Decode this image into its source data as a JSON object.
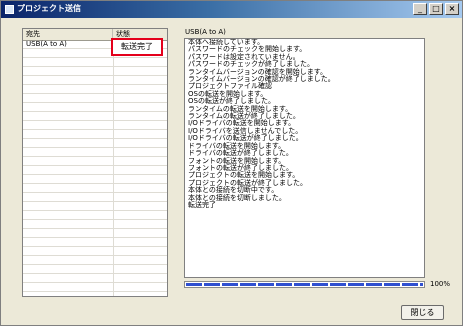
{
  "window": {
    "title": "プロジェクト送信",
    "minimize_glyph": "_",
    "maximize_glyph": "□",
    "close_glyph": "×"
  },
  "list": {
    "headers": {
      "destination": "宛先",
      "status": "状態"
    },
    "rows": [
      {
        "destination": "USB(A to A)",
        "status": "転送完了"
      }
    ]
  },
  "log": {
    "label": "USB(A to A)",
    "lines": [
      "本体へ接続しています。",
      "パスワードのチェックを開始します。",
      "パスワードは設定されていません。",
      "パスワードのチェックが終了しました。",
      "ランタイムバージョンの確認を開始します。",
      "ランタイムバージョンの確認が終了しました。",
      "プロジェクトファイル確認",
      "OSの転送を開始します。",
      "OSの転送が終了しました。",
      "ランタイムの転送を開始します。",
      "ランタイムの転送が終了しました。",
      "I/Oドライバの転送を開始します。",
      "I/Oドライバを送信しませんでした。",
      "I/Oドライバの転送が終了しました。",
      "ドライバの転送を開始します。",
      "ドライバの転送が終了しました。",
      "フォントの転送を開始します。",
      "フォントの転送が終了しました。",
      "プロジェクトの転送を開始します。",
      "プロジェクトの転送が終了しました。",
      "本体との接続を切断中です。",
      "本体との接続を切断しました。",
      "転送完了"
    ]
  },
  "progress": {
    "value": 100,
    "label": "100%"
  },
  "buttons": {
    "close_label": "閉じる"
  },
  "colors": {
    "highlight_border": "#e4001b",
    "progress_fill": "#2f4fd0"
  }
}
